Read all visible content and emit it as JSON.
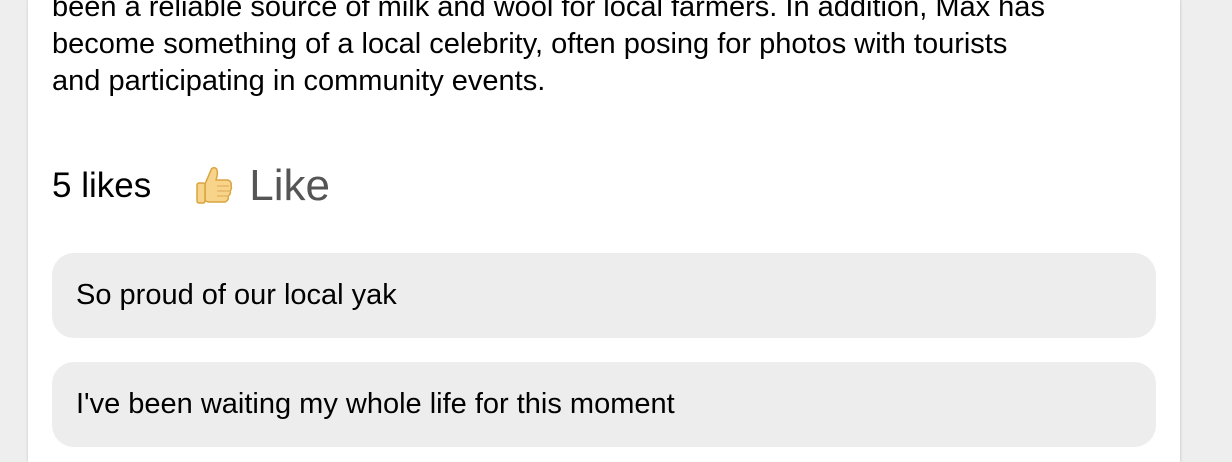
{
  "post": {
    "body_lines": [
      "been a reliable source of milk and wool for local farmers. In addition, Max has",
      "become something of a local celebrity, often posing for photos with tourists",
      "and participating in community events."
    ]
  },
  "likes": {
    "count_text": "5 likes",
    "button_label": "Like",
    "button_icon": "thumbs-up-icon"
  },
  "comments": [
    {
      "text": "So proud of our local yak"
    },
    {
      "text": "I've been waiting my whole life for this moment"
    }
  ],
  "colors": {
    "page_background": "#eeeeee",
    "card_background": "#ffffff",
    "comment_background": "#ededed",
    "like_text": "#555555",
    "thumb_fill": "#f7d48a"
  }
}
